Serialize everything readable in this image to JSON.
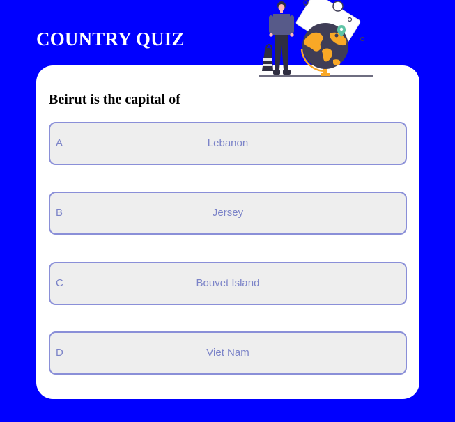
{
  "app": {
    "title": "COUNTRY QUIZ"
  },
  "illustration": {
    "icon": "traveler-with-globe-illustration"
  },
  "question": {
    "text": "Beirut is the capital of"
  },
  "options": [
    {
      "letter": "A",
      "answer": "Lebanon"
    },
    {
      "letter": "B",
      "answer": "Jersey"
    },
    {
      "letter": "C",
      "answer": "Bouvet Island"
    },
    {
      "letter": "D",
      "answer": "Viet Nam"
    }
  ],
  "colors": {
    "background": "#0000ff",
    "card": "#ffffff",
    "option_background": "#eeeeee",
    "option_border": "#8a8fd8",
    "option_text": "#7b83c8",
    "globe_land": "#f9a826",
    "globe_sea": "#3f3d56",
    "pin": "#5ec4a5"
  }
}
